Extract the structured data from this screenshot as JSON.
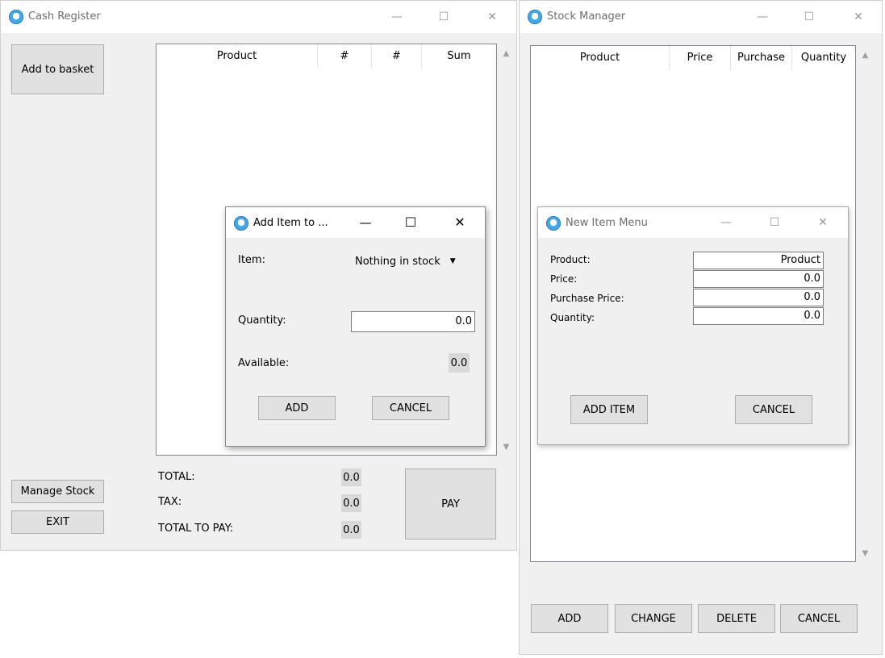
{
  "cash_register": {
    "title": "Cash Register",
    "controls": {
      "minimize": "—",
      "maximize": "☐",
      "close": "✕"
    },
    "add_to_basket": "Add to basket",
    "table_headers": [
      "Product",
      "#",
      "#",
      "Sum"
    ],
    "total_label": "TOTAL:",
    "total_value": "0.0",
    "tax_label": "TAX:",
    "tax_value": "0.0",
    "total_to_pay_label": "TOTAL TO PAY:",
    "total_to_pay_value": "0.0",
    "pay": "PAY",
    "manage_stock": "Manage Stock",
    "exit": "EXIT"
  },
  "add_item_dialog": {
    "title": "Add Item to ...",
    "controls": {
      "minimize": "—",
      "maximize": "☐",
      "close": "✕"
    },
    "item_label": "Item:",
    "item_value": "Nothing in stock",
    "quantity_label": "Quantity:",
    "quantity_value": "0.0",
    "available_label": "Available:",
    "available_value": "0.0",
    "add": "ADD",
    "cancel": "CANCEL"
  },
  "stock_manager": {
    "title": "Stock Manager",
    "controls": {
      "minimize": "—",
      "maximize": "☐",
      "close": "✕"
    },
    "table_headers": [
      "Product",
      "Price",
      "Purchase",
      "Quantity"
    ],
    "add": "ADD",
    "change": "CHANGE",
    "delete": "DELETE",
    "cancel": "CANCEL"
  },
  "new_item_dialog": {
    "title": "New Item Menu",
    "controls": {
      "minimize": "—",
      "maximize": "☐",
      "close": "✕"
    },
    "product_label": "Product:",
    "product_value": "Product",
    "price_label": "Price:",
    "price_value": "0.0",
    "purchase_price_label": "Purchase Price:",
    "purchase_price_value": "0.0",
    "quantity_label": "Quantity:",
    "quantity_value": "0.0",
    "add_item": "ADD ITEM",
    "cancel": "CANCEL"
  },
  "colors": {
    "window_bg": "#f0f0f0",
    "titlebar_bg": "#ffffff",
    "button_bg": "#e1e1e1",
    "button_border": "#adadad",
    "value_box_bg": "#d9d9d9",
    "app_icon": "#45a8e6"
  },
  "icons": {
    "app": "app-icon",
    "dropdown": "chevron-down-icon",
    "scroll_up": "scroll-up-arrow-icon",
    "scroll_down": "scroll-down-arrow-icon"
  }
}
